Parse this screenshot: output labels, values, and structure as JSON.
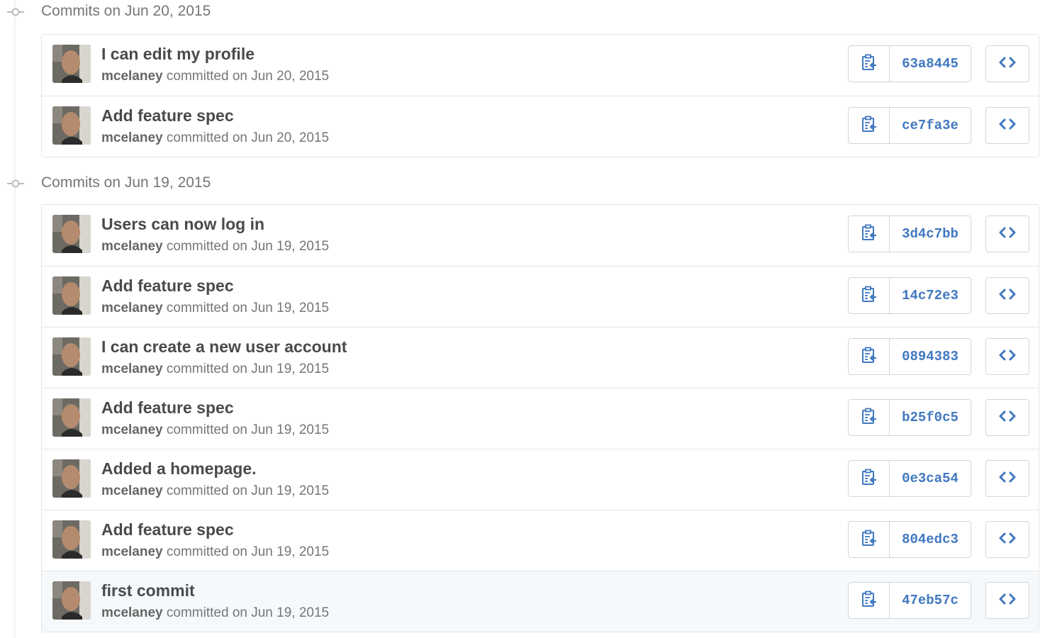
{
  "groups": [
    {
      "title": "Commits on Jun 20, 2015",
      "commits": [
        {
          "title": "I can edit my profile",
          "author": "mcelaney",
          "meta": "committed on Jun 20, 2015",
          "sha": "63a8445"
        },
        {
          "title": "Add feature spec",
          "author": "mcelaney",
          "meta": "committed on Jun 20, 2015",
          "sha": "ce7fa3e"
        }
      ]
    },
    {
      "title": "Commits on Jun 19, 2015",
      "commits": [
        {
          "title": "Users can now log in",
          "author": "mcelaney",
          "meta": "committed on Jun 19, 2015",
          "sha": "3d4c7bb"
        },
        {
          "title": "Add feature spec",
          "author": "mcelaney",
          "meta": "committed on Jun 19, 2015",
          "sha": "14c72e3"
        },
        {
          "title": "I can create a new user account",
          "author": "mcelaney",
          "meta": "committed on Jun 19, 2015",
          "sha": "0894383"
        },
        {
          "title": "Add feature spec",
          "author": "mcelaney",
          "meta": "committed on Jun 19, 2015",
          "sha": "b25f0c5"
        },
        {
          "title": "Added a homepage.",
          "author": "mcelaney",
          "meta": "committed on Jun 19, 2015",
          "sha": "0e3ca54"
        },
        {
          "title": "Add feature spec",
          "author": "mcelaney",
          "meta": "committed on Jun 19, 2015",
          "sha": "804edc3"
        },
        {
          "title": "first commit",
          "author": "mcelaney",
          "meta": "committed on Jun 19, 2015",
          "sha": "47eb57c",
          "highlighted": true
        }
      ]
    }
  ],
  "icons": {
    "group": "git-commit-icon",
    "copy": "clippy-icon",
    "browse": "code-icon"
  },
  "colors": {
    "sha": "#4078c0",
    "icon": "#4078c0",
    "highlight_row": "#f5f9fc",
    "border": "#e5e5e5"
  }
}
